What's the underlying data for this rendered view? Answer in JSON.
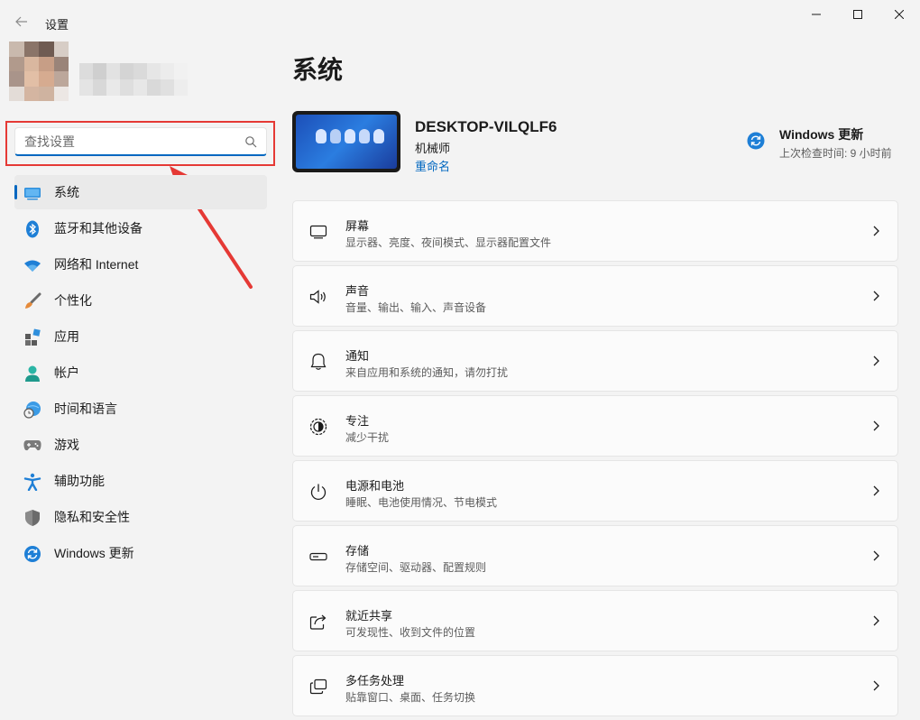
{
  "window": {
    "title": "设置"
  },
  "search": {
    "placeholder": "查找设置"
  },
  "sidebar": {
    "items": [
      {
        "label": "系统",
        "icon": "system-icon",
        "active": true
      },
      {
        "label": "蓝牙和其他设备",
        "icon": "bluetooth-icon"
      },
      {
        "label": "网络和 Internet",
        "icon": "wifi-icon"
      },
      {
        "label": "个性化",
        "icon": "brush-icon"
      },
      {
        "label": "应用",
        "icon": "apps-icon"
      },
      {
        "label": "帐户",
        "icon": "account-icon"
      },
      {
        "label": "时间和语言",
        "icon": "globe-clock-icon"
      },
      {
        "label": "游戏",
        "icon": "gamepad-icon"
      },
      {
        "label": "辅助功能",
        "icon": "accessibility-icon"
      },
      {
        "label": "隐私和安全性",
        "icon": "shield-icon"
      },
      {
        "label": "Windows 更新",
        "icon": "update-icon"
      }
    ]
  },
  "main": {
    "title": "系统",
    "device": {
      "name": "DESKTOP-VILQLF6",
      "user": "机械师",
      "rename": "重命名"
    },
    "update": {
      "title": "Windows 更新",
      "status": "上次检查时间: 9 小时前"
    },
    "cards": [
      {
        "title": "屏幕",
        "subtitle": "显示器、亮度、夜间模式、显示器配置文件",
        "icon": "monitor-icon"
      },
      {
        "title": "声音",
        "subtitle": "音量、输出、输入、声音设备",
        "icon": "speaker-icon"
      },
      {
        "title": "通知",
        "subtitle": "来自应用和系统的通知，请勿打扰",
        "icon": "bell-icon"
      },
      {
        "title": "专注",
        "subtitle": "减少干扰",
        "icon": "focus-icon"
      },
      {
        "title": "电源和电池",
        "subtitle": "睡眠、电池使用情况、节电模式",
        "icon": "power-icon"
      },
      {
        "title": "存储",
        "subtitle": "存储空间、驱动器、配置规则",
        "icon": "storage-icon"
      },
      {
        "title": "就近共享",
        "subtitle": "可发现性、收到文件的位置",
        "icon": "share-icon"
      },
      {
        "title": "多任务处理",
        "subtitle": "贴靠窗口、桌面、任务切换",
        "icon": "multitask-icon"
      }
    ]
  },
  "colors": {
    "accent": "#0067c0",
    "highlight": "#e53935",
    "background": "#f3f3f3"
  }
}
